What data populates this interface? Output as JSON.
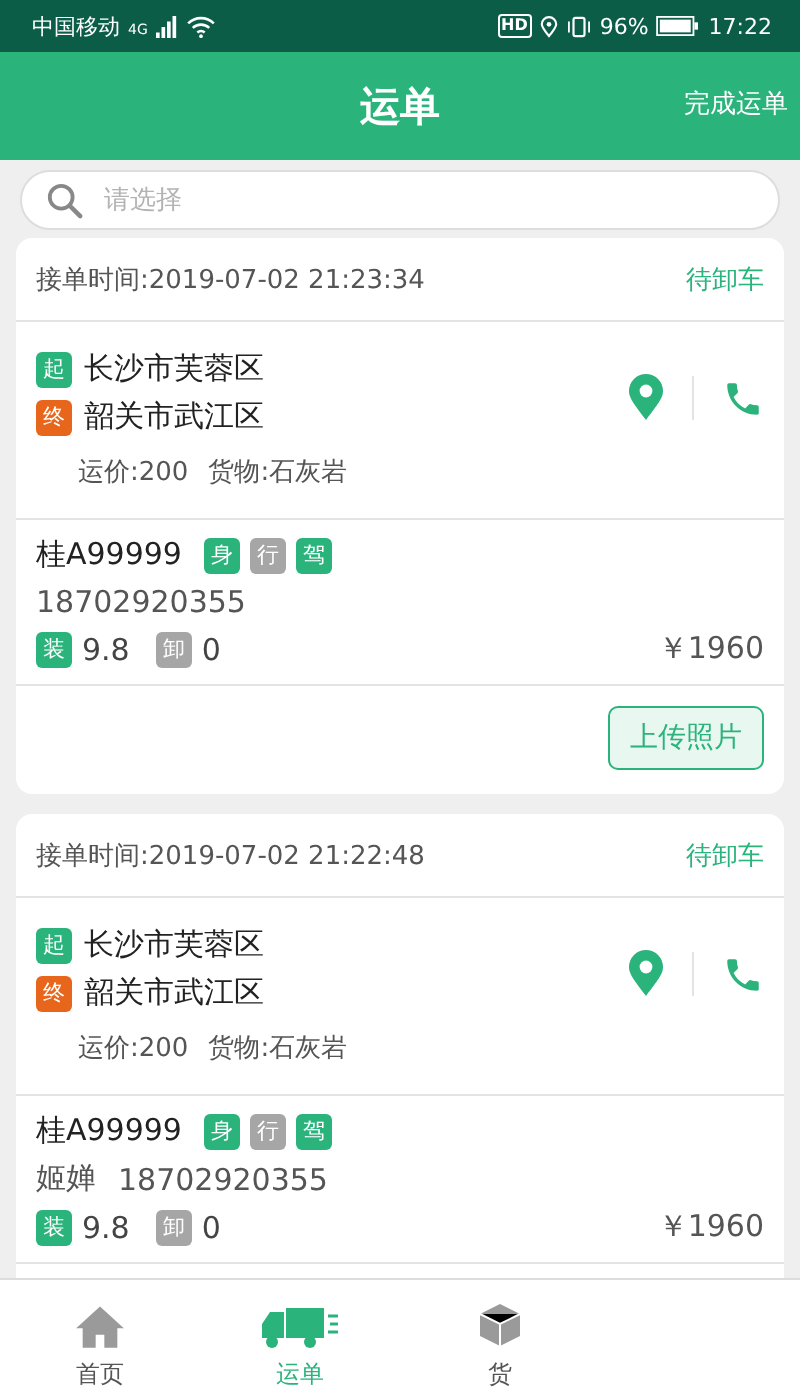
{
  "status_bar": {
    "carrier": "中国移动",
    "network": "4G",
    "hd": "HD",
    "battery": "96%",
    "time": "17:22"
  },
  "header": {
    "title": "运单",
    "action": "完成运单"
  },
  "search": {
    "placeholder": "请选择"
  },
  "orders": [
    {
      "time": "接单时间:2019-07-02 21:23:34",
      "status": "待卸车",
      "origin_tag": "起",
      "origin": "长沙市芙蓉区",
      "dest_tag": "终",
      "destination": "韶关市武江区",
      "freight": "运价:200",
      "cargo": "货物:石灰岩",
      "plate": "桂A99999",
      "docs": [
        {
          "label": "身",
          "verified": true
        },
        {
          "label": "行",
          "verified": false
        },
        {
          "label": "驾",
          "verified": true
        }
      ],
      "phone": "18702920355",
      "load": {
        "label": "装",
        "done": true,
        "value": "9.8"
      },
      "unload": {
        "label": "卸",
        "done": false,
        "value": "0"
      },
      "amount": "￥1960",
      "button": "上传照片"
    },
    {
      "time": "接单时间:2019-07-02 21:22:48",
      "status": "待卸车",
      "origin_tag": "起",
      "origin": "长沙市芙蓉区",
      "dest_tag": "终",
      "destination": "韶关市武江区",
      "freight": "运价:200",
      "cargo": "货物:石灰岩",
      "plate": "桂A99999",
      "docs": [
        {
          "label": "身",
          "verified": true
        },
        {
          "label": "行",
          "verified": false
        },
        {
          "label": "驾",
          "verified": true
        }
      ],
      "driver": "姬婵",
      "phone": "18702920355",
      "load": {
        "label": "装",
        "done": true,
        "value": "9.8"
      },
      "unload": {
        "label": "卸",
        "done": false,
        "value": "0"
      },
      "amount": "￥1960"
    }
  ],
  "tabs": [
    {
      "kind": "home",
      "label": "首页",
      "selected": false
    },
    {
      "kind": "truck",
      "label": "运单",
      "selected": true
    },
    {
      "kind": "box",
      "label": "货",
      "selected": false
    }
  ]
}
